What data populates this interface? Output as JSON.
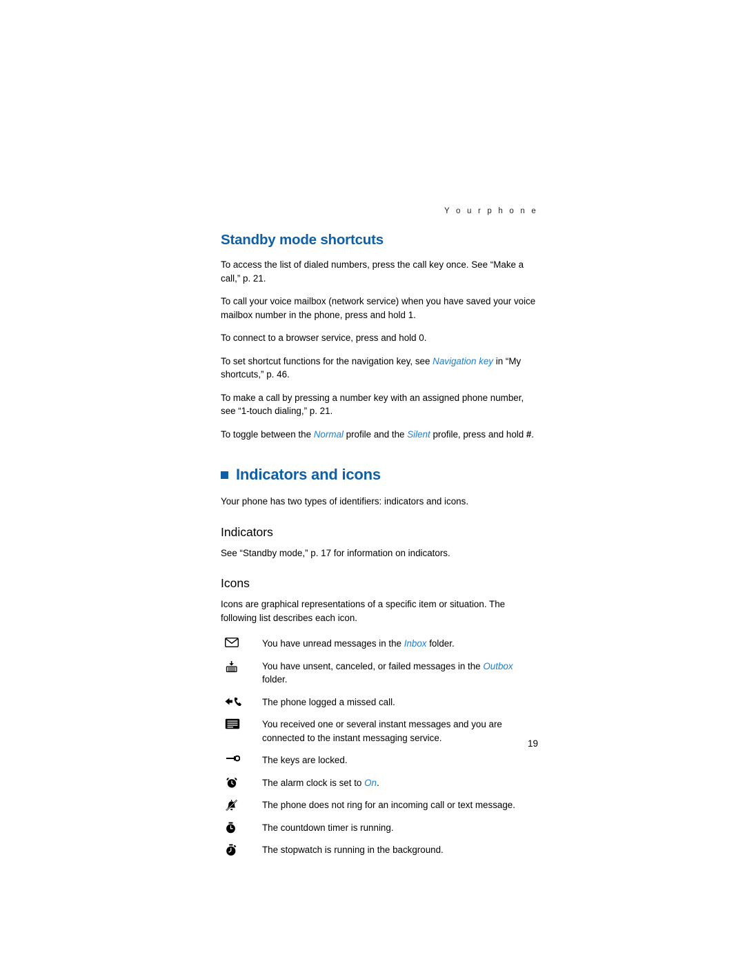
{
  "running_head": "Y o u r   p h o n e",
  "page_number": "19",
  "sections": {
    "standby": {
      "title": "Standby mode shortcuts",
      "paragraphs": [
        "To access the list of dialed numbers, press the call key once. See “Make a call,” p. 21.",
        "To call your voice mailbox (network service) when you have saved your voice mailbox number in the phone, press and hold 1.",
        "To connect to a browser service, press and hold 0."
      ],
      "para_nav_pre": "To set shortcut functions for the navigation key, see ",
      "para_nav_italic": "Navigation key",
      "para_nav_post": " in “My shortcuts,” p. 46.",
      "para_onetouch": "To make a call by pressing a number key with an assigned phone number, see “1-touch dialing,” p. 21.",
      "para_toggle_pre": "To toggle between the ",
      "para_toggle_normal": "Normal",
      "para_toggle_mid": " profile and the ",
      "para_toggle_silent": "Silent",
      "para_toggle_post": " profile, press and hold ",
      "para_toggle_key": "#",
      "para_toggle_end": "."
    },
    "indicators_and_icons": {
      "title": "Indicators and icons",
      "intro": "Your phone has two types of identifiers: indicators and icons.",
      "indicators": {
        "title": "Indicators",
        "text": "See “Standby mode,” p. 17 for information on indicators."
      },
      "icons": {
        "title": "Icons",
        "text": "Icons are graphical representations of a specific item or situation. The following list describes each icon.",
        "items": [
          {
            "icon": "envelope-icon",
            "text_pre": "You have unread messages in the ",
            "text_italic": "Inbox",
            "text_post": " folder."
          },
          {
            "icon": "outbox-icon",
            "text_pre": "You have unsent, canceled, or failed messages in the ",
            "text_italic": "Outbox",
            "text_post": " folder."
          },
          {
            "icon": "missed-call-icon",
            "text_pre": "The phone logged a missed call.",
            "text_italic": "",
            "text_post": ""
          },
          {
            "icon": "instant-message-icon",
            "text_pre": "You received one or several instant messages and you are connected to the instant messaging service.",
            "text_italic": "",
            "text_post": ""
          },
          {
            "icon": "keylock-icon",
            "text_pre": "The keys are locked.",
            "text_italic": "",
            "text_post": ""
          },
          {
            "icon": "alarm-clock-icon",
            "text_pre": "The alarm clock is set to ",
            "text_italic": "On",
            "text_post": "."
          },
          {
            "icon": "silent-ring-icon",
            "text_pre": "The phone does not ring for an incoming call or text message.",
            "text_italic": "",
            "text_post": ""
          },
          {
            "icon": "countdown-timer-icon",
            "text_pre": "The countdown timer is running.",
            "text_italic": "",
            "text_post": ""
          },
          {
            "icon": "stopwatch-icon",
            "text_pre": "The stopwatch is running in the background.",
            "text_italic": "",
            "text_post": ""
          }
        ]
      }
    }
  },
  "colors": {
    "heading_blue": "#0f5fa6",
    "italic_blue": "#1a7fd4"
  }
}
